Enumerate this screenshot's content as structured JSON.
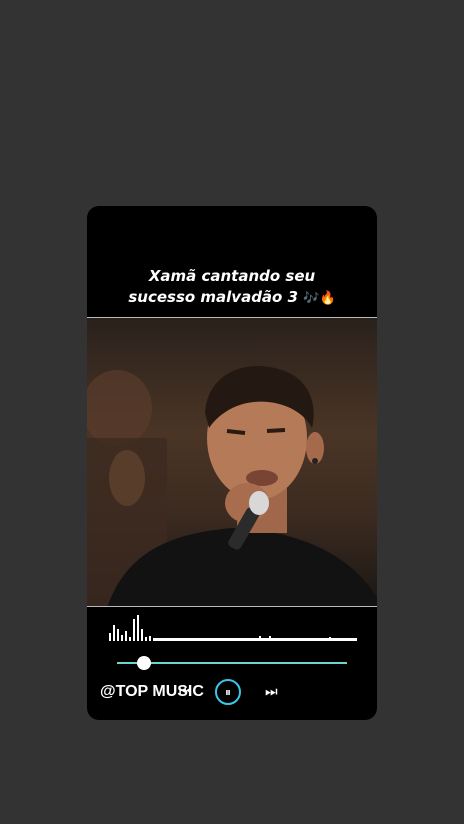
{
  "post": {
    "caption_line1": "Xamã cantando seu",
    "caption_line2": "sucesso malvadão 3",
    "caption_emoji": "🎶🔥"
  },
  "player": {
    "handle": "@TOP MUSIC",
    "prev_icon": "⏮",
    "play_pause_icon": "⏸",
    "next_icon": "⏭",
    "progress": 0.12,
    "accent_color": "#6fd3d0"
  },
  "video": {
    "description_icon": "singer-video-frame"
  }
}
